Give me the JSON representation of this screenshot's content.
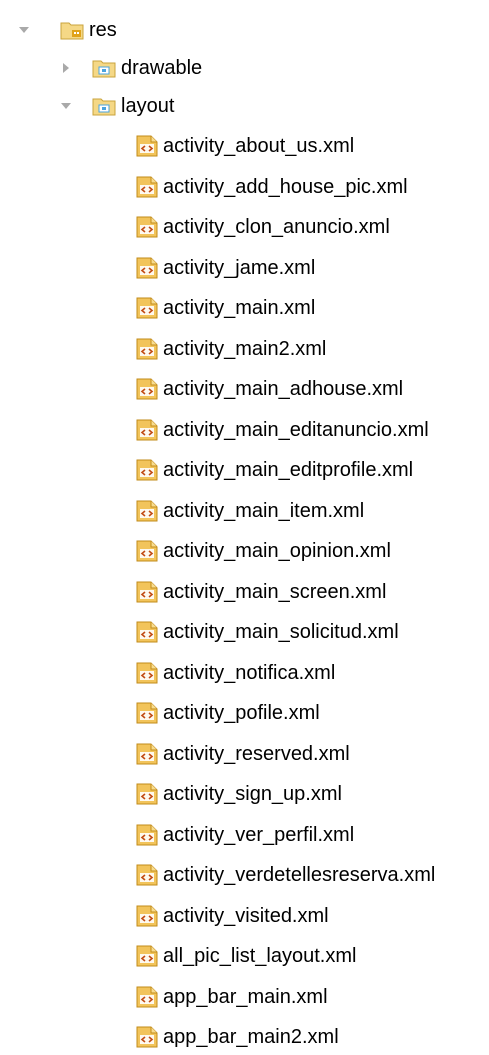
{
  "tree": {
    "root": {
      "label": "res",
      "expanded": true,
      "icon": "resources-folder-icon"
    },
    "folders": [
      {
        "label": "drawable",
        "expanded": false,
        "icon": "package-folder-icon"
      },
      {
        "label": "layout",
        "expanded": true,
        "icon": "package-folder-icon"
      }
    ],
    "files": [
      "activity_about_us.xml",
      "activity_add_house_pic.xml",
      "activity_clon_anuncio.xml",
      "activity_jame.xml",
      "activity_main.xml",
      "activity_main2.xml",
      "activity_main_adhouse.xml",
      "activity_main_editanuncio.xml",
      "activity_main_editprofile.xml",
      "activity_main_item.xml",
      "activity_main_opinion.xml",
      "activity_main_screen.xml",
      "activity_main_solicitud.xml",
      "activity_notifica.xml",
      "activity_pofile.xml",
      "activity_reserved.xml",
      "activity_sign_up.xml",
      "activity_ver_perfil.xml",
      "activity_verdetellesreserva.xml",
      "activity_visited.xml",
      "all_pic_list_layout.xml",
      "app_bar_main.xml",
      "app_bar_main2.xml"
    ],
    "file_icon": "xml-file-icon"
  },
  "colors": {
    "arrow": "#a9a9a9",
    "folder_fill": "#f5d886",
    "folder_stroke": "#c9a33c",
    "folder_badge": "#4aa3df",
    "res_badge": "#e0a21a",
    "xml_fill": "#f2c45b",
    "xml_stroke": "#c28b1a",
    "xml_glyph": "#c14b14"
  }
}
